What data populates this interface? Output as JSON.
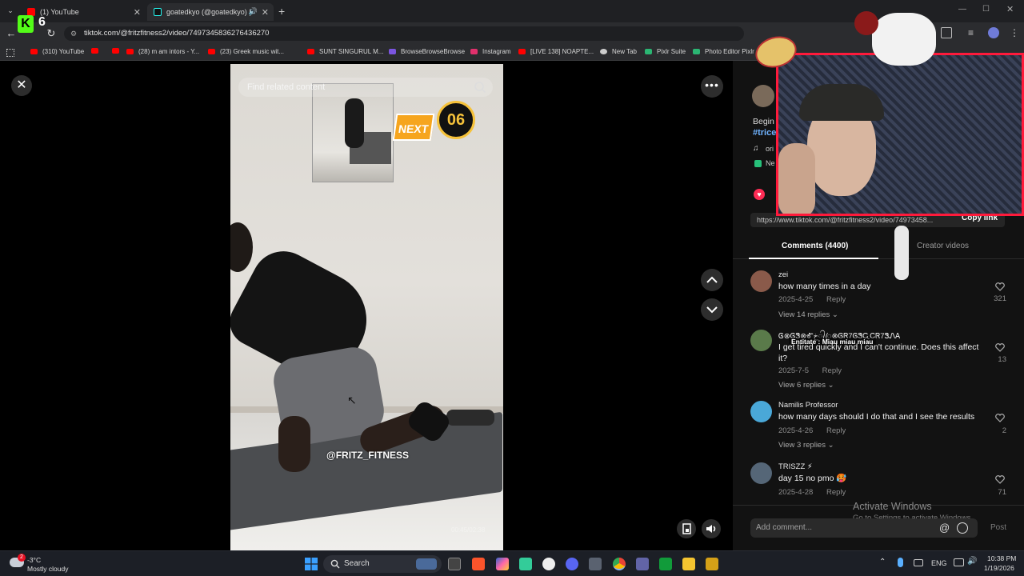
{
  "browser": {
    "tabs": [
      {
        "title": "(1) YouTube",
        "favicon_color": "#ff0000"
      },
      {
        "title": "goatedkyo (@goatedkyo) |",
        "favicon_color": "#111111"
      }
    ],
    "new_tab_symbol": "+",
    "url": "tiktok.com/@fritzfitness2/video/7497345836276436270",
    "bookmarks": [
      {
        "label": "(310) YouTube",
        "icon_color": "#ff0000"
      },
      {
        "label": "(28) m am intors - Y...",
        "icon_color": "#ff0000"
      },
      {
        "label": "(23) Greek music wit...",
        "icon_color": "#ff0000"
      },
      {
        "label": "SUNT SINGURUL M...",
        "icon_color": "#ff0000"
      },
      {
        "label": "BrowseBrowseBrowse",
        "icon_color": "#7b55e0"
      },
      {
        "label": "Instagram",
        "icon_color": "#e1306c"
      },
      {
        "label": "[LIVE 138] NOAPTE...",
        "icon_color": "#ff0000"
      },
      {
        "label": "New Tab",
        "icon_color": "#cccccc"
      },
      {
        "label": "Pixlr Suite",
        "icon_color": "#2bb673"
      },
      {
        "label": "Photo Editor Pixlr",
        "icon_color": "#2bb673"
      }
    ],
    "kick_badge": "6"
  },
  "video": {
    "search_placeholder": "Find related content",
    "next_label": "NEXT",
    "timer": "06",
    "watermark": "@FRITZ_FITNESS",
    "timecode": "00:45/02:38"
  },
  "panel": {
    "caption_partial": "Begin",
    "hashtag_partial": "#trice",
    "music_partial": "ori",
    "other_partial": "Ne",
    "link": "https://www.tiktok.com/@fritzfitness2/video/74973458...",
    "copy_link": "Copy link",
    "tab_comments": "Comments (4400)",
    "tab_creator": "Creator videos",
    "comments": [
      {
        "user": "zei",
        "text": "how many times in a day",
        "date": "2025-4-25",
        "reply": "Reply",
        "view": "View 14 replies",
        "likes": "321",
        "avatar_color": "#8a5a4a"
      },
      {
        "user": "Ꮆ⊗ᎶᏕ⊗Ꮉخ᭄ꦿ⊗ᎶᏒ7ᎶᏕᏩᏟᏒ7ᏕᏁᎪ",
        "overlay": "Entitate : Miau miau miau",
        "text": "I get tired quickly and I can't continue. Does this affect it?",
        "date": "2025-7-5",
        "reply": "Reply",
        "view": "View 6 replies",
        "likes": "13",
        "avatar_color": "#5a7a4a"
      },
      {
        "user": "Namilis Professor",
        "text": "how many days should I do that and I see the results",
        "date": "2025-4-26",
        "reply": "Reply",
        "view": "View 3 replies",
        "likes": "2",
        "avatar_color": "#4aa8d8"
      },
      {
        "user": "TRISZZ ⚡",
        "text": "day 15 no pmo 🥵",
        "date": "2025-4-28",
        "reply": "Reply",
        "view": "",
        "likes": "71",
        "avatar_color": "#556677"
      }
    ],
    "add_comment": "Add comment...",
    "post": "Post"
  },
  "os": {
    "activate_title": "Activate Windows",
    "activate_sub": "Go to Settings to activate Windows.",
    "weather_temp": "-3°C",
    "weather_desc": "Mostly cloudy",
    "weather_badge": "2",
    "search_label": "Search",
    "lang": "ENG",
    "time": "10:38 PM",
    "date": "1/19/2026"
  }
}
